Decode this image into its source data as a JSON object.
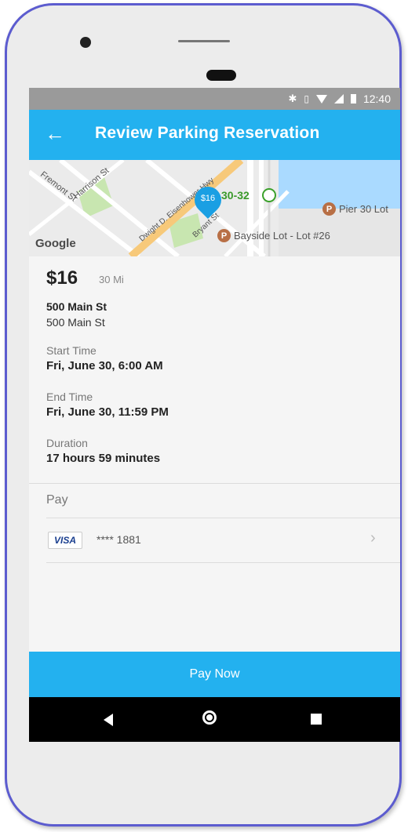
{
  "status_bar": {
    "time": "12:40",
    "icons": [
      "bluetooth-icon",
      "vibrate-icon",
      "wifi-icon",
      "signal-icon",
      "battery-icon"
    ]
  },
  "app_bar": {
    "back_icon": "arrow-back-icon",
    "title": "Review Parking Reservation",
    "color": "#23b1ef"
  },
  "map": {
    "street_labels": [
      "Fremont St",
      "Harrison St",
      "Dwight D. Eisenhower Hwy",
      "Bryant St"
    ],
    "pin_price": "$16",
    "green_marker": "30-32",
    "pois": [
      "Pier 30 Lot",
      "Bayside Lot - Lot #26"
    ],
    "poi_icon": "P",
    "attribution": "Google"
  },
  "reservation": {
    "price": "$16",
    "distance": "30 Mi",
    "address_line1": "500 Main St",
    "address_line2": "500 Main St",
    "start_label": "Start Time",
    "start_value": "Fri, June 30, 6:00 AM",
    "end_label": "End Time",
    "end_value": "Fri, June 30, 11:59 PM",
    "duration_label": "Duration",
    "duration_value": "17 hours 59 minutes"
  },
  "payment": {
    "label": "Pay",
    "card_brand": "VISA",
    "card_number": "**** 1881",
    "chevron_icon": "chevron-right-icon"
  },
  "pay_button": {
    "label": "Pay Now",
    "color": "#23b1ef"
  },
  "nav_bar": {
    "icons": [
      "nav-back-icon",
      "nav-home-icon",
      "nav-recents-icon"
    ]
  }
}
